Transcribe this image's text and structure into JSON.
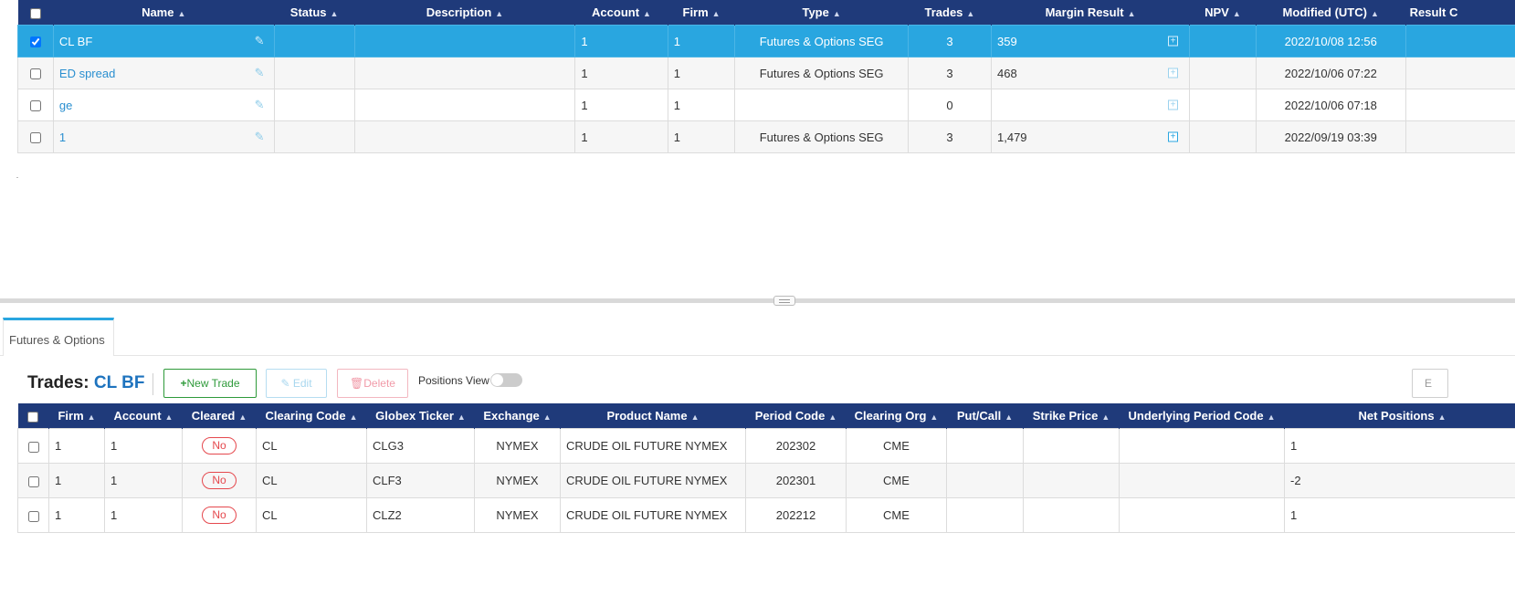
{
  "portfolio_grid": {
    "columns": [
      "Name",
      "Status",
      "Description",
      "Account",
      "Firm",
      "Type",
      "Trades",
      "Margin Result",
      "NPV",
      "Modified (UTC)",
      "Result C"
    ],
    "rows": [
      {
        "name": "CL BF",
        "status": "",
        "description": "",
        "account": "1",
        "firm": "1",
        "type": "Futures & Options SEG",
        "trades": "3",
        "margin": "359",
        "npv": "",
        "modified": "2022/10/08 12:56",
        "result": "",
        "selected": true
      },
      {
        "name": "ED spread",
        "status": "",
        "description": "",
        "account": "1",
        "firm": "1",
        "type": "Futures & Options SEG",
        "trades": "3",
        "margin": "468",
        "npv": "",
        "modified": "2022/10/06 07:22",
        "result": "",
        "selected": false
      },
      {
        "name": "ge",
        "status": "",
        "description": "",
        "account": "1",
        "firm": "1",
        "type": "",
        "trades": "0",
        "margin": "",
        "npv": "",
        "modified": "2022/10/06 07:18",
        "result": "",
        "selected": false
      },
      {
        "name": "1",
        "status": "",
        "description": "",
        "account": "1",
        "firm": "1",
        "type": "Futures & Options SEG",
        "trades": "3",
        "margin": "1,479",
        "npv": "",
        "modified": "2022/09/19 03:39",
        "result": "",
        "selected": false
      }
    ]
  },
  "tabs": {
    "futures_options": "Futures & Options"
  },
  "trades": {
    "title_prefix": "Trades:",
    "portfolio_name": "CL BF",
    "new_trade": "New Trade",
    "edit": "Edit",
    "delete": "Delete",
    "positions_view": "Positions View",
    "export_label": "E",
    "columns": [
      "Firm",
      "Account",
      "Cleared",
      "Clearing Code",
      "Globex Ticker",
      "Exchange",
      "Product Name",
      "Period Code",
      "Clearing Org",
      "Put/Call",
      "Strike Price",
      "Underlying Period Code",
      "Net Positions"
    ],
    "rows": [
      {
        "firm": "1",
        "account": "1",
        "cleared": "No",
        "clearing_code": "CL",
        "globex_ticker": "CLG3",
        "exchange": "NYMEX",
        "product_name": "CRUDE OIL FUTURE NYMEX",
        "period_code": "202302",
        "clearing_org": "CME",
        "put_call": "",
        "strike_price": "",
        "underlying_period_code": "",
        "net_positions": "1"
      },
      {
        "firm": "1",
        "account": "1",
        "cleared": "No",
        "clearing_code": "CL",
        "globex_ticker": "CLF3",
        "exchange": "NYMEX",
        "product_name": "CRUDE OIL FUTURE NYMEX",
        "period_code": "202301",
        "clearing_org": "CME",
        "put_call": "",
        "strike_price": "",
        "underlying_period_code": "",
        "net_positions": "-2"
      },
      {
        "firm": "1",
        "account": "1",
        "cleared": "No",
        "clearing_code": "CL",
        "globex_ticker": "CLZ2",
        "exchange": "NYMEX",
        "product_name": "CRUDE OIL FUTURE NYMEX",
        "period_code": "202212",
        "clearing_org": "CME",
        "put_call": "",
        "strike_price": "",
        "underlying_period_code": "",
        "net_positions": "1"
      }
    ]
  },
  "colors": {
    "header": "#1f3a7a",
    "selected_row": "#29a6e0",
    "accent": "#1e73be",
    "new_trade": "#2e9a3a",
    "badge": "#e5484d"
  }
}
